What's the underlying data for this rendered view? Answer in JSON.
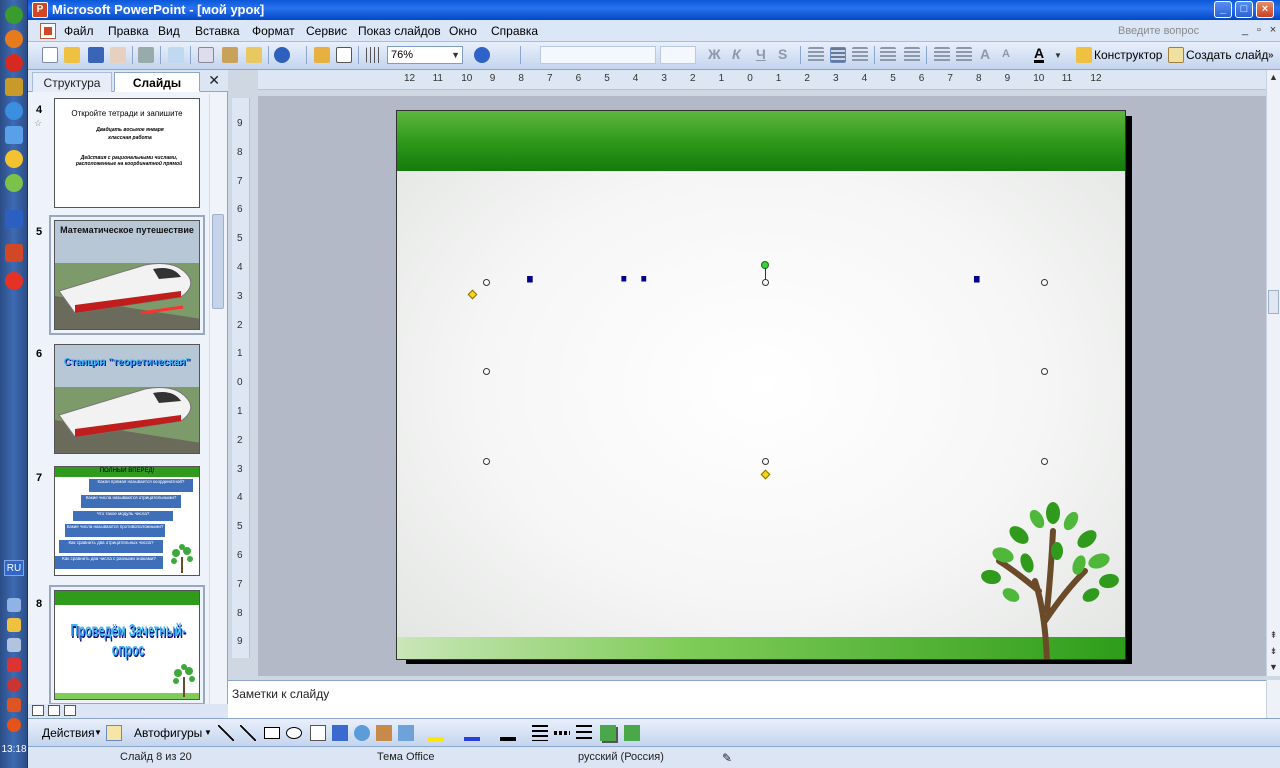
{
  "window": {
    "title": "Microsoft PowerPoint - [мой урок]",
    "app_icon_letter": "P"
  },
  "menu": {
    "items": [
      "Файл",
      "Правка",
      "Вид",
      "Вставка",
      "Формат",
      "Сервис",
      "Показ слайдов",
      "Окно",
      "Справка"
    ],
    "ask_placeholder": "Введите вопрос"
  },
  "toolbar": {
    "zoom": "76%",
    "designer_label": "Конструктор",
    "new_slide_label": "Создать слайд"
  },
  "left_pane": {
    "tabs": [
      "Структура",
      "Слайды"
    ],
    "active_tab": "Слайды",
    "slides": [
      {
        "number": "4",
        "title": "Откройте тетради и запишите",
        "lines": [
          "Двадцать восьмое января",
          "классная работа",
          "Действия с рациональными числами, расположенные на координатной прямой"
        ]
      },
      {
        "number": "5",
        "title": "Математическое путешествие"
      },
      {
        "number": "6",
        "title": "Станция \"теоретическая\""
      },
      {
        "number": "7",
        "title": "ПОЛНЫЙ ВПЕРЕД!",
        "arrows": [
          "Какая прямая называется координатной?",
          "Какие числа называются отрицательными?",
          "Что такое модуль числа?",
          "Какие числа называются противоположными?",
          "Как сравнить два отрицательных числа?",
          "Как сравнить два числа с разными знаками?"
        ]
      },
      {
        "number": "8",
        "title": "Проведём Зачетный-опрос"
      }
    ]
  },
  "ruler": {
    "horizontal": [
      "12",
      "11",
      "10",
      "9",
      "8",
      "7",
      "6",
      "5",
      "4",
      "3",
      "2",
      "1",
      "0",
      "1",
      "2",
      "3",
      "4",
      "5",
      "6",
      "7",
      "8",
      "9",
      "10",
      "11",
      "12"
    ],
    "vertical": [
      "9",
      "8",
      "7",
      "6",
      "5",
      "4",
      "3",
      "2",
      "1",
      "0",
      "1",
      "2",
      "3",
      "4",
      "5",
      "6",
      "7",
      "8",
      "9"
    ]
  },
  "slide": {
    "wordart_text": "Проведём Зачетный-опрос",
    "colors": {
      "wordart_fill": "#46c0f5",
      "wordart_outline": "#0a0a8c",
      "shadow": "#00008b",
      "band_green": "#2f9a1b"
    }
  },
  "notes": {
    "placeholder": "Заметки к слайду"
  },
  "drawing_toolbar": {
    "actions_label": "Действия",
    "autoshapes_label": "Автофигуры"
  },
  "status": {
    "slide_counter": "Слайд 8 из 20",
    "theme": "Тема Office",
    "language": "русский (Россия)"
  },
  "taskbar": {
    "language": "RU",
    "clock": "13:18"
  }
}
